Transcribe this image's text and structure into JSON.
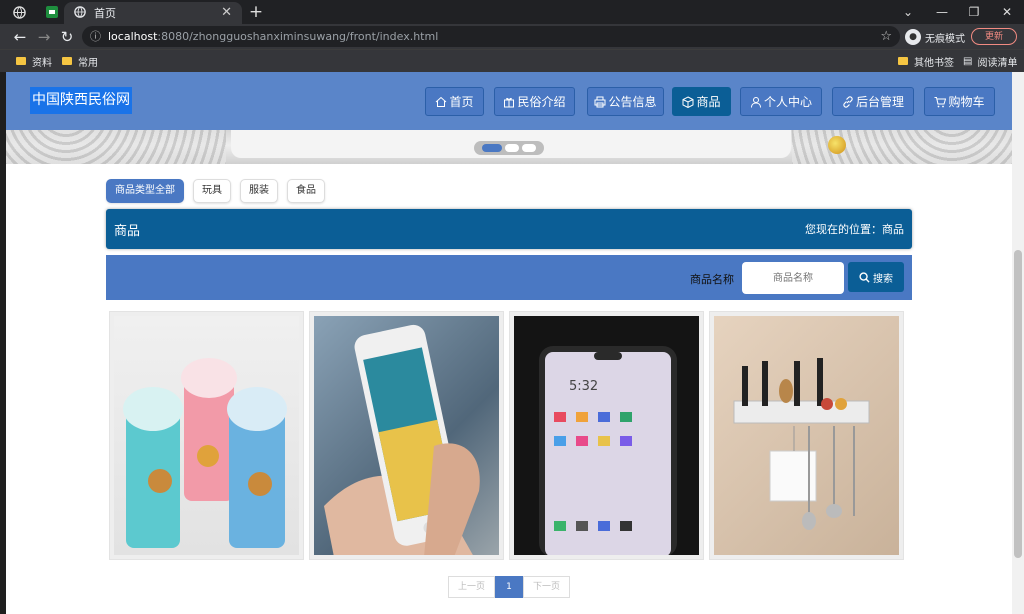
{
  "browser": {
    "tab_title": "首页",
    "url_host": "localhost",
    "url_path": ":8080/zhongguoshanximinsuwang/front/index.html",
    "incognito_label": "无痕模式",
    "update_label": "更新",
    "bookmarks": [
      "资料",
      "常用"
    ],
    "other_bookmarks": "其他书签",
    "reading_list": "阅读清单"
  },
  "site": {
    "logo": "中国陕西民俗网",
    "nav": [
      {
        "label": "首页",
        "icon": "home-icon"
      },
      {
        "label": "民俗介绍",
        "icon": "gift-icon"
      },
      {
        "label": "公告信息",
        "icon": "printer-icon"
      },
      {
        "label": "商品",
        "icon": "box-icon",
        "active": true
      },
      {
        "label": "个人中心",
        "icon": "user-icon"
      },
      {
        "label": "后台管理",
        "icon": "link-icon"
      },
      {
        "label": "购物车",
        "icon": "cart-icon"
      }
    ]
  },
  "filters": [
    {
      "label": "商品类型全部",
      "active": true
    },
    {
      "label": "玩具"
    },
    {
      "label": "服装"
    },
    {
      "label": "食品"
    }
  ],
  "section": {
    "title": "商品",
    "location_label": "您现在的位置：",
    "location_value": "商品"
  },
  "search": {
    "label": "商品名称",
    "placeholder": "商品名称",
    "button": "搜索"
  },
  "products": [
    {
      "name": "cups",
      "image": "cartoon-cups-image"
    },
    {
      "name": "iphone",
      "image": "phone-in-hand-image"
    },
    {
      "name": "android-phone",
      "image": "smartphone-image"
    },
    {
      "name": "kitchen-rack",
      "image": "utensil-rack-image"
    }
  ],
  "pagination": {
    "prev": "上一页",
    "current": "1",
    "next": "下一页"
  },
  "colors": {
    "header": "#5a85c9",
    "primary_dark": "#0b5e96",
    "logo_bg": "#1a73e8"
  }
}
